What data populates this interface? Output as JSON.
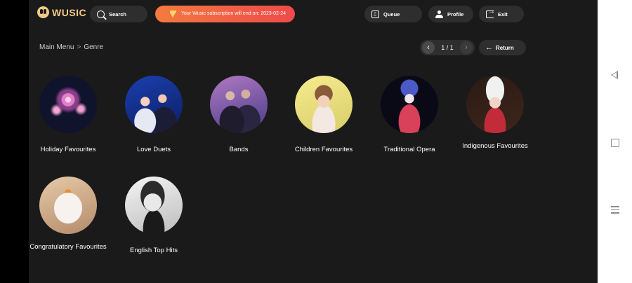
{
  "app": {
    "logo_text": "WUSIC"
  },
  "header": {
    "search_label": "Search",
    "subscription_text": "Your Wusic subscription will end on: 2023-02-24",
    "queue_label": "Queue",
    "profile_label": "Profile",
    "exit_label": "Exit"
  },
  "breadcrumb": {
    "root": "Main Menu",
    "separator": ">",
    "current": "Genre"
  },
  "pager": {
    "prev": "‹",
    "indicator": "1 / 1",
    "next": "›",
    "return_label": "Return"
  },
  "genres": [
    {
      "label": "Holiday Favourites"
    },
    {
      "label": "Love Duets"
    },
    {
      "label": "Bands"
    },
    {
      "label": "Children Favourites"
    },
    {
      "label": "Traditional Opera"
    },
    {
      "label": "Indigenous Favourites"
    },
    {
      "label": "Congratulatory Favourites"
    },
    {
      "label": "English Top Hits"
    }
  ],
  "colors": {
    "background": "#1a1a1a",
    "pill": "#2e2e2e",
    "accent_gold": "#f2c98a",
    "banner_start": "#f47a3f",
    "banner_end": "#ef4a4a"
  },
  "icons": {
    "search": "search-icon",
    "queue": "queue-icon",
    "profile": "profile-icon",
    "exit": "exit-icon",
    "subscription": "diamond-icon",
    "return": "back-arrow-icon",
    "system_back": "back-tri-icon",
    "system_home": "home-icon",
    "system_recents": "recents-icon"
  }
}
